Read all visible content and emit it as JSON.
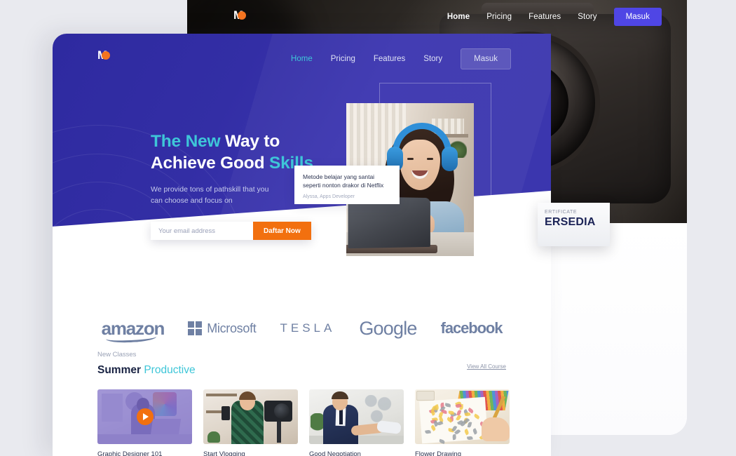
{
  "background_mockup": {
    "nav": {
      "logo": "M",
      "links": [
        {
          "label": "Home",
          "active": true
        },
        {
          "label": "Pricing",
          "active": false
        },
        {
          "label": "Features",
          "active": false
        },
        {
          "label": "Story",
          "active": false
        }
      ],
      "cta_label": "Masuk"
    },
    "certificate_card": {
      "kicker": "ERTIFICATE",
      "title": "ERSEDIA"
    }
  },
  "foreground_mockup": {
    "nav": {
      "logo": "M",
      "links": [
        {
          "label": "Home",
          "active": true
        },
        {
          "label": "Pricing",
          "active": false
        },
        {
          "label": "Features",
          "active": false
        },
        {
          "label": "Story",
          "active": false
        }
      ],
      "cta_label": "Masuk"
    },
    "hero": {
      "heading_line1_accent": "The New",
      "heading_line1_rest": " Way to",
      "heading_line2_rest": "Achieve Good ",
      "heading_line2_accent": "Skills",
      "subtitle_line1": "We provide tons of pathskill that you",
      "subtitle_line2": "can choose and focus on",
      "email_placeholder": "Your email address",
      "email_value": "",
      "submit_label": "Daftar Now",
      "testimonial": {
        "quote_line1": "Metode belajar yang santai",
        "quote_line2": "seperti nonton drakor di Netflix",
        "author": "Alyssa, Apps Developer"
      }
    },
    "brands": [
      {
        "name": "amazon",
        "icon": "amazon-logo"
      },
      {
        "name": "Microsoft",
        "icon": "microsoft-logo"
      },
      {
        "name": "TESLA",
        "icon": "tesla-logo"
      },
      {
        "name": "Google",
        "icon": "google-logo"
      },
      {
        "name": "facebook",
        "icon": "facebook-logo"
      }
    ],
    "classes": {
      "eyebrow": "New Classes",
      "title_strong": "Summer ",
      "title_accent": "Productive",
      "view_all_label": "View All Course",
      "cards": [
        {
          "title": "Graphic Designer 101",
          "has_play": true
        },
        {
          "title": "Start Vlogging",
          "has_play": false
        },
        {
          "title": "Good Negotiation",
          "has_play": false
        },
        {
          "title": "Flower Drawing",
          "has_play": false
        }
      ]
    }
  },
  "colors": {
    "page_bg": "#e9eaef",
    "hero_blue": "#332ea5",
    "accent_teal": "#3ec6d8",
    "accent_orange": "#f2700f",
    "bg_masuk_blue": "#4f46e5",
    "brand_gray": "#6f80a3",
    "dark_text": "#182242"
  }
}
